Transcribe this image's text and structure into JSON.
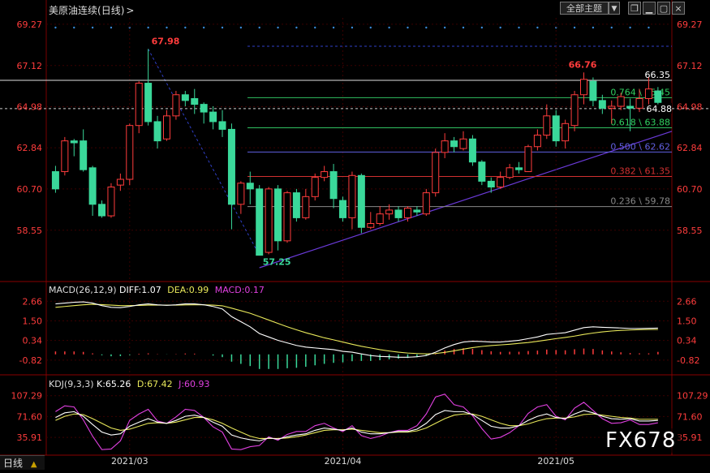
{
  "header": {
    "title": "美原油连续",
    "period": "(日线)",
    "period_arrow": ">",
    "theme_button": "全部主题",
    "dropdown_icon": "▼",
    "window_icons": [
      "restore-icon",
      "minimize-icon",
      "maximize-icon",
      "close-icon"
    ]
  },
  "macd_header": {
    "label": "MACD(26,12,9)",
    "diff": "DIFF:1.07",
    "dea": "DEA:0.99",
    "macd": "MACD:0.17"
  },
  "kdj_header": {
    "label": "KDJ(9,3,3)",
    "k": "K:65.26",
    "d": "D:67.42",
    "j": "J:60.93"
  },
  "footer": {
    "period_tab": "日线",
    "watermark": "FX678"
  },
  "colors": {
    "up": "#ff3c3c",
    "down": "#3ad89a",
    "dif": "#ffffff",
    "dea": "#e8e85a",
    "macd_text": "#e040e0",
    "trend": "#6a3ad8",
    "fib": "#30c060",
    "grid": "#3a0000"
  },
  "chart_data": [
    {
      "type": "candlestick",
      "title": "美原油连续(日线)",
      "y_ticks": [
        "69.27",
        "67.12",
        "64.98",
        "62.84",
        "60.70",
        "58.55"
      ],
      "ylim": [
        56.6,
        69.6
      ],
      "x_ticks": [
        {
          "label": "2021/03",
          "index": 8
        },
        {
          "label": "2021/04",
          "index": 31
        },
        {
          "label": "2021/05",
          "index": 54
        }
      ],
      "current_price": "64.88",
      "annotations": [
        {
          "text": "67.98",
          "value": 67.98,
          "index": 10
        },
        {
          "text": "57.25",
          "value": 57.25,
          "index": 22
        },
        {
          "text": "66.76",
          "value": 66.76,
          "index": 55
        }
      ],
      "levels": [
        {
          "text": "66.35",
          "value": 66.35,
          "kind": "horizontal"
        },
        {
          "text": "0.764 \\ 65.45",
          "value": 65.45,
          "kind": "fib"
        },
        {
          "text": "0.618 \\ 63.88",
          "value": 63.88,
          "kind": "fib"
        },
        {
          "text": "0.500 \\ 62.62",
          "value": 62.62,
          "kind": "fib"
        },
        {
          "text": "0.382 \\ 61.35",
          "value": 61.35,
          "kind": "fib"
        },
        {
          "text": "0.236 \\ 59.78",
          "value": 59.78,
          "kind": "fib"
        }
      ],
      "candles": [
        [
          61.6,
          60.7,
          61.9,
          60.5
        ],
        [
          61.6,
          63.2,
          63.4,
          61.4
        ],
        [
          63.2,
          63.1,
          63.3,
          62.4
        ],
        [
          63.2,
          61.7,
          63.8,
          61.6
        ],
        [
          61.8,
          59.9,
          61.9,
          59.3
        ],
        [
          59.9,
          59.3,
          60.1,
          59.2
        ],
        [
          59.3,
          60.8,
          61.0,
          59.2
        ],
        [
          60.9,
          61.2,
          61.5,
          60.6
        ],
        [
          61.2,
          64.0,
          64.1,
          60.9
        ],
        [
          64.0,
          66.2,
          66.3,
          63.6
        ],
        [
          66.2,
          64.2,
          67.98,
          64.0
        ],
        [
          64.2,
          63.2,
          64.5,
          62.8
        ],
        [
          63.3,
          64.5,
          64.8,
          63.2
        ],
        [
          64.5,
          65.6,
          65.8,
          64.3
        ],
        [
          65.6,
          65.3,
          65.8,
          65.0
        ],
        [
          65.4,
          65.1,
          65.9,
          64.6
        ],
        [
          65.1,
          64.7,
          65.2,
          64.1
        ],
        [
          64.7,
          64.2,
          65.0,
          63.8
        ],
        [
          64.2,
          63.8,
          64.8,
          63.4
        ],
        [
          63.8,
          59.9,
          64.1,
          58.6
        ],
        [
          59.9,
          61.0,
          61.1,
          59.4
        ],
        [
          61.0,
          60.7,
          61.6,
          59.9
        ],
        [
          60.7,
          57.25,
          60.9,
          57.25
        ],
        [
          57.4,
          60.7,
          60.8,
          57.3
        ],
        [
          60.7,
          58.0,
          60.9,
          57.5
        ],
        [
          58.0,
          60.5,
          60.6,
          57.9
        ],
        [
          60.5,
          59.2,
          60.7,
          59.0
        ],
        [
          59.2,
          60.3,
          60.7,
          59.1
        ],
        [
          60.3,
          61.3,
          61.5,
          60.1
        ],
        [
          61.3,
          61.6,
          61.9,
          61.1
        ],
        [
          61.6,
          60.2,
          62.0,
          59.7
        ],
        [
          60.1,
          59.2,
          60.3,
          59.0
        ],
        [
          59.2,
          61.4,
          61.6,
          58.6
        ],
        [
          61.4,
          58.7,
          61.5,
          58.4
        ],
        [
          58.7,
          58.9,
          59.5,
          58.6
        ],
        [
          58.9,
          59.4,
          59.8,
          58.8
        ],
        [
          59.4,
          59.6,
          59.9,
          59.1
        ],
        [
          59.6,
          59.2,
          59.8,
          59.0
        ],
        [
          59.2,
          59.7,
          59.8,
          59.0
        ],
        [
          59.6,
          59.5,
          59.8,
          59.3
        ],
        [
          59.4,
          60.5,
          60.7,
          59.3
        ],
        [
          60.5,
          62.6,
          62.8,
          60.3
        ],
        [
          62.6,
          63.2,
          63.6,
          62.3
        ],
        [
          63.2,
          62.9,
          63.4,
          62.6
        ],
        [
          62.8,
          63.3,
          63.7,
          62.7
        ],
        [
          63.3,
          62.1,
          63.5,
          61.9
        ],
        [
          62.1,
          61.1,
          62.2,
          60.9
        ],
        [
          61.1,
          60.8,
          61.3,
          60.5
        ],
        [
          60.8,
          61.3,
          61.6,
          60.7
        ],
        [
          61.3,
          61.8,
          62.0,
          61.2
        ],
        [
          61.8,
          61.7,
          62.1,
          61.5
        ],
        [
          61.6,
          62.9,
          63.0,
          61.6
        ],
        [
          62.9,
          63.5,
          63.8,
          62.7
        ],
        [
          63.5,
          64.5,
          65.1,
          63.3
        ],
        [
          64.5,
          63.2,
          64.8,
          62.9
        ],
        [
          63.2,
          64.1,
          64.3,
          62.8
        ],
        [
          64.0,
          65.6,
          65.8,
          63.7
        ],
        [
          65.6,
          66.4,
          66.76,
          65.1
        ],
        [
          66.3,
          65.3,
          66.5,
          65.0
        ],
        [
          65.3,
          64.9,
          65.6,
          64.6
        ],
        [
          64.9,
          65.0,
          65.3,
          64.1
        ],
        [
          65.0,
          65.5,
          65.7,
          64.8
        ],
        [
          65.0,
          64.9,
          65.4,
          63.7
        ],
        [
          64.9,
          65.4,
          65.9,
          64.7
        ],
        [
          65.4,
          65.9,
          66.5,
          65.1
        ],
        [
          65.8,
          65.2,
          66.0,
          65.1
        ]
      ]
    },
    {
      "type": "line",
      "title": "MACD(26,12,9)",
      "y_ticks": [
        "2.66",
        "1.50",
        "0.34",
        "-0.82"
      ],
      "ylim": [
        -1.4,
        3.2
      ],
      "dif": [
        2.5,
        2.55,
        2.6,
        2.62,
        2.55,
        2.4,
        2.3,
        2.28,
        2.35,
        2.45,
        2.5,
        2.45,
        2.42,
        2.45,
        2.5,
        2.5,
        2.45,
        2.35,
        2.2,
        1.75,
        1.45,
        1.15,
        0.75,
        0.55,
        0.35,
        0.2,
        0.05,
        -0.05,
        -0.1,
        -0.15,
        -0.2,
        -0.3,
        -0.35,
        -0.45,
        -0.55,
        -0.6,
        -0.62,
        -0.65,
        -0.65,
        -0.62,
        -0.55,
        -0.35,
        -0.1,
        0.1,
        0.25,
        0.3,
        0.28,
        0.25,
        0.25,
        0.3,
        0.35,
        0.45,
        0.55,
        0.7,
        0.75,
        0.8,
        0.95,
        1.1,
        1.15,
        1.12,
        1.1,
        1.08,
        1.05,
        1.05,
        1.06,
        1.07
      ],
      "dea": [
        2.3,
        2.35,
        2.4,
        2.45,
        2.48,
        2.46,
        2.43,
        2.4,
        2.4,
        2.41,
        2.43,
        2.43,
        2.43,
        2.43,
        2.44,
        2.45,
        2.45,
        2.43,
        2.39,
        2.25,
        2.1,
        1.95,
        1.75,
        1.55,
        1.35,
        1.15,
        0.97,
        0.8,
        0.65,
        0.5,
        0.38,
        0.25,
        0.12,
        0.0,
        -0.1,
        -0.2,
        -0.28,
        -0.35,
        -0.4,
        -0.43,
        -0.45,
        -0.43,
        -0.36,
        -0.27,
        -0.17,
        -0.08,
        -0.01,
        0.04,
        0.08,
        0.12,
        0.17,
        0.22,
        0.29,
        0.37,
        0.45,
        0.52,
        0.6,
        0.7,
        0.78,
        0.85,
        0.9,
        0.94,
        0.96,
        0.98,
        0.99,
        0.99
      ],
      "macd": [
        0.2,
        0.2,
        0.2,
        0.17,
        0.07,
        -0.06,
        -0.13,
        -0.12,
        -0.05,
        0.04,
        0.07,
        0.02,
        -0.01,
        0.02,
        0.06,
        0.05,
        0.0,
        -0.08,
        -0.19,
        -0.5,
        -0.65,
        -0.8,
        -1.0,
        -1.0,
        -1.0,
        -0.95,
        -0.92,
        -0.85,
        -0.75,
        -0.65,
        -0.58,
        -0.55,
        -0.47,
        -0.45,
        -0.45,
        -0.4,
        -0.34,
        -0.3,
        -0.25,
        -0.19,
        -0.1,
        0.08,
        0.26,
        0.37,
        0.42,
        0.38,
        0.29,
        0.21,
        0.17,
        0.18,
        0.18,
        0.23,
        0.26,
        0.33,
        0.3,
        0.28,
        0.35,
        0.4,
        0.37,
        0.27,
        0.2,
        0.14,
        0.09,
        0.07,
        0.07,
        0.17
      ]
    },
    {
      "type": "line",
      "title": "KDJ(9,3,3)",
      "y_ticks": [
        "107.29",
        "71.60",
        "35.91"
      ],
      "ylim": [
        18,
        125
      ],
      "k": [
        70,
        78,
        80,
        72,
        58,
        45,
        40,
        42,
        55,
        62,
        68,
        62,
        60,
        65,
        72,
        74,
        70,
        62,
        55,
        40,
        35,
        32,
        30,
        35,
        33,
        37,
        40,
        42,
        48,
        52,
        50,
        48,
        52,
        45,
        42,
        42,
        44,
        46,
        46,
        50,
        60,
        75,
        82,
        80,
        80,
        75,
        65,
        55,
        52,
        52,
        56,
        65,
        72,
        76,
        70,
        68,
        76,
        82,
        78,
        72,
        68,
        67,
        68,
        64,
        64,
        65
      ],
      "d": [
        65,
        72,
        76,
        75,
        68,
        60,
        52,
        48,
        50,
        55,
        60,
        61,
        60,
        62,
        66,
        70,
        70,
        66,
        60,
        52,
        45,
        38,
        34,
        34,
        34,
        35,
        37,
        40,
        44,
        48,
        49,
        49,
        50,
        48,
        46,
        44,
        44,
        45,
        45,
        47,
        52,
        60,
        68,
        74,
        76,
        76,
        72,
        66,
        60,
        56,
        56,
        59,
        64,
        68,
        69,
        69,
        71,
        75,
        76,
        74,
        72,
        70,
        69,
        67,
        67,
        67
      ],
      "j": [
        80,
        90,
        88,
        66,
        38,
        15,
        16,
        30,
        65,
        76,
        84,
        64,
        60,
        71,
        84,
        82,
        70,
        54,
        45,
        16,
        15,
        20,
        22,
        37,
        31,
        41,
        46,
        46,
        56,
        60,
        52,
        46,
        56,
        39,
        34,
        38,
        44,
        48,
        48,
        56,
        76,
        105,
        110,
        92,
        88,
        73,
        51,
        33,
        36,
        44,
        56,
        77,
        88,
        92,
        72,
        66,
        86,
        96,
        82,
        68,
        60,
        61,
        66,
        58,
        58,
        61
      ]
    }
  ]
}
